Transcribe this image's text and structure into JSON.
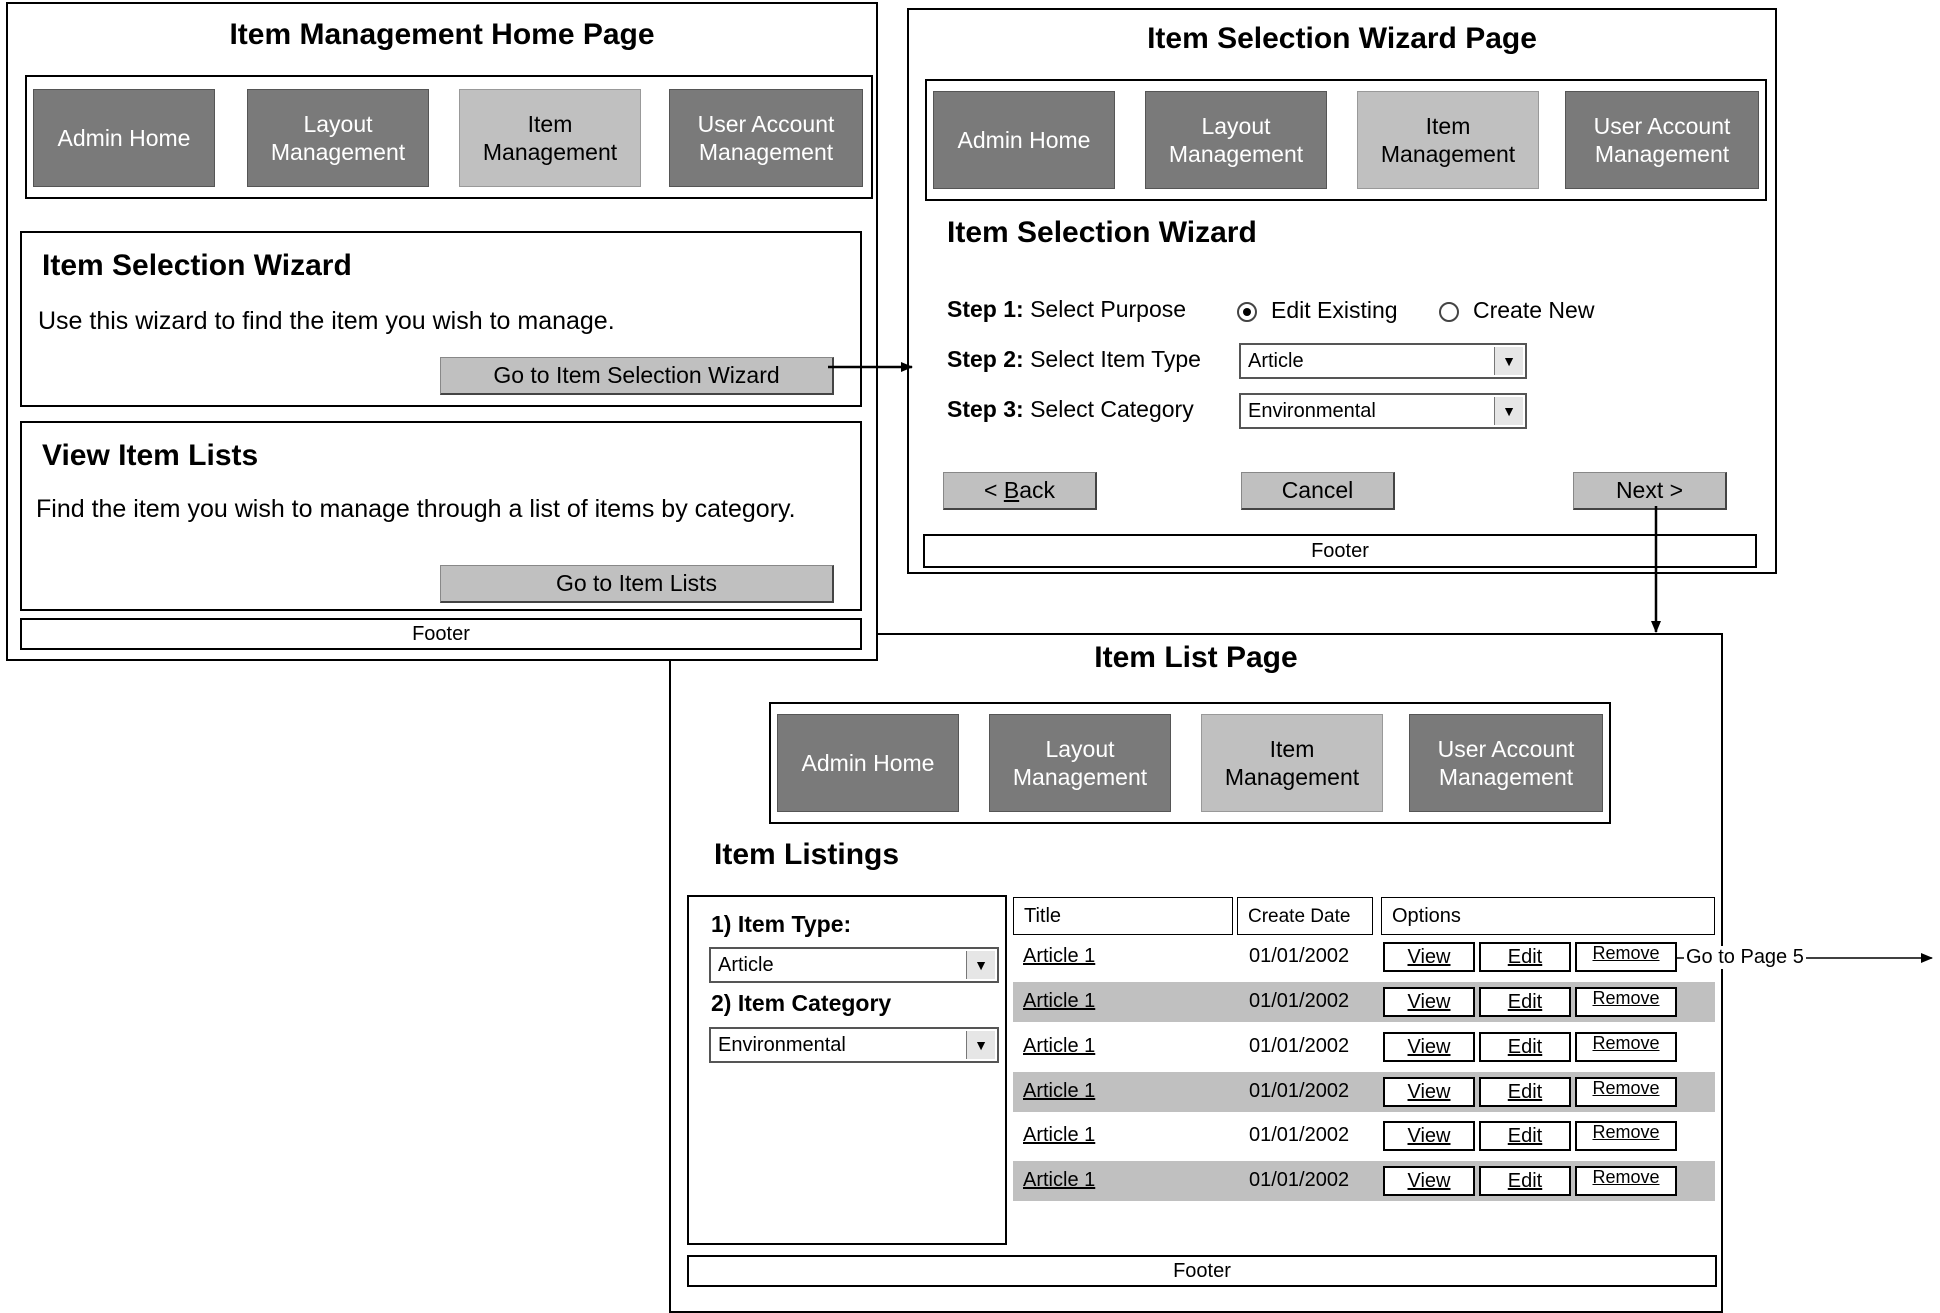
{
  "nav": {
    "admin_home": "Admin Home",
    "layout_management": "Layout Management",
    "item_management": "Item Management",
    "user_account_management": "User Account Management"
  },
  "home_page": {
    "title": "Item Management  Home Page",
    "wizard_section": {
      "heading": "Item Selection Wizard",
      "text": "Use this wizard to find the item you wish to manage.",
      "button": "Go to Item Selection Wizard"
    },
    "lists_section": {
      "heading": "View Item Lists",
      "text": "Find the item you wish to manage through a list of items by category.",
      "button": "Go to Item Lists"
    },
    "footer": "Footer"
  },
  "wizard_page": {
    "title": "Item Selection Wizard Page",
    "heading": "Item Selection Wizard",
    "step1": {
      "label_bold": "Step 1:",
      "label": " Select Purpose",
      "option_edit": "Edit Existing",
      "option_create": "Create New",
      "selected": "Edit Existing"
    },
    "step2": {
      "label_bold": "Step 2:",
      "label": " Select Item Type",
      "value": "Article"
    },
    "step3": {
      "label_bold": "Step 3:",
      "label": " Select Category",
      "value": "Environmental"
    },
    "back_prefix": "< ",
    "back_underlined": "B",
    "back_rest": "ack",
    "cancel": "Cancel",
    "next": "Next >",
    "footer": "Footer"
  },
  "list_page": {
    "title": "Item List Page",
    "heading": "Item Listings",
    "filter": {
      "type_label": "1) Item Type:",
      "type_value": "Article",
      "category_label": "2) Item Category",
      "category_value": "Environmental"
    },
    "columns": {
      "title": "Title",
      "create_date": "Create Date",
      "options": "Options"
    },
    "option_labels": {
      "view": "View",
      "edit": "Edit",
      "remove": "Remove"
    },
    "rows": [
      {
        "title": "Article 1",
        "date": "01/01/2002"
      },
      {
        "title": "Article 1",
        "date": "01/01/2002"
      },
      {
        "title": "Article 1",
        "date": "01/01/2002"
      },
      {
        "title": "Article 1",
        "date": "01/01/2002"
      },
      {
        "title": "Article 1",
        "date": "01/01/2002"
      },
      {
        "title": "Article 1",
        "date": "01/01/2002"
      }
    ],
    "goto_label": "Go to Page 5",
    "footer": "Footer"
  },
  "colors": {
    "nav_dark": "#7a7a7a",
    "nav_selected": "#c0c0c0",
    "row_shade": "#c0c0c0"
  }
}
